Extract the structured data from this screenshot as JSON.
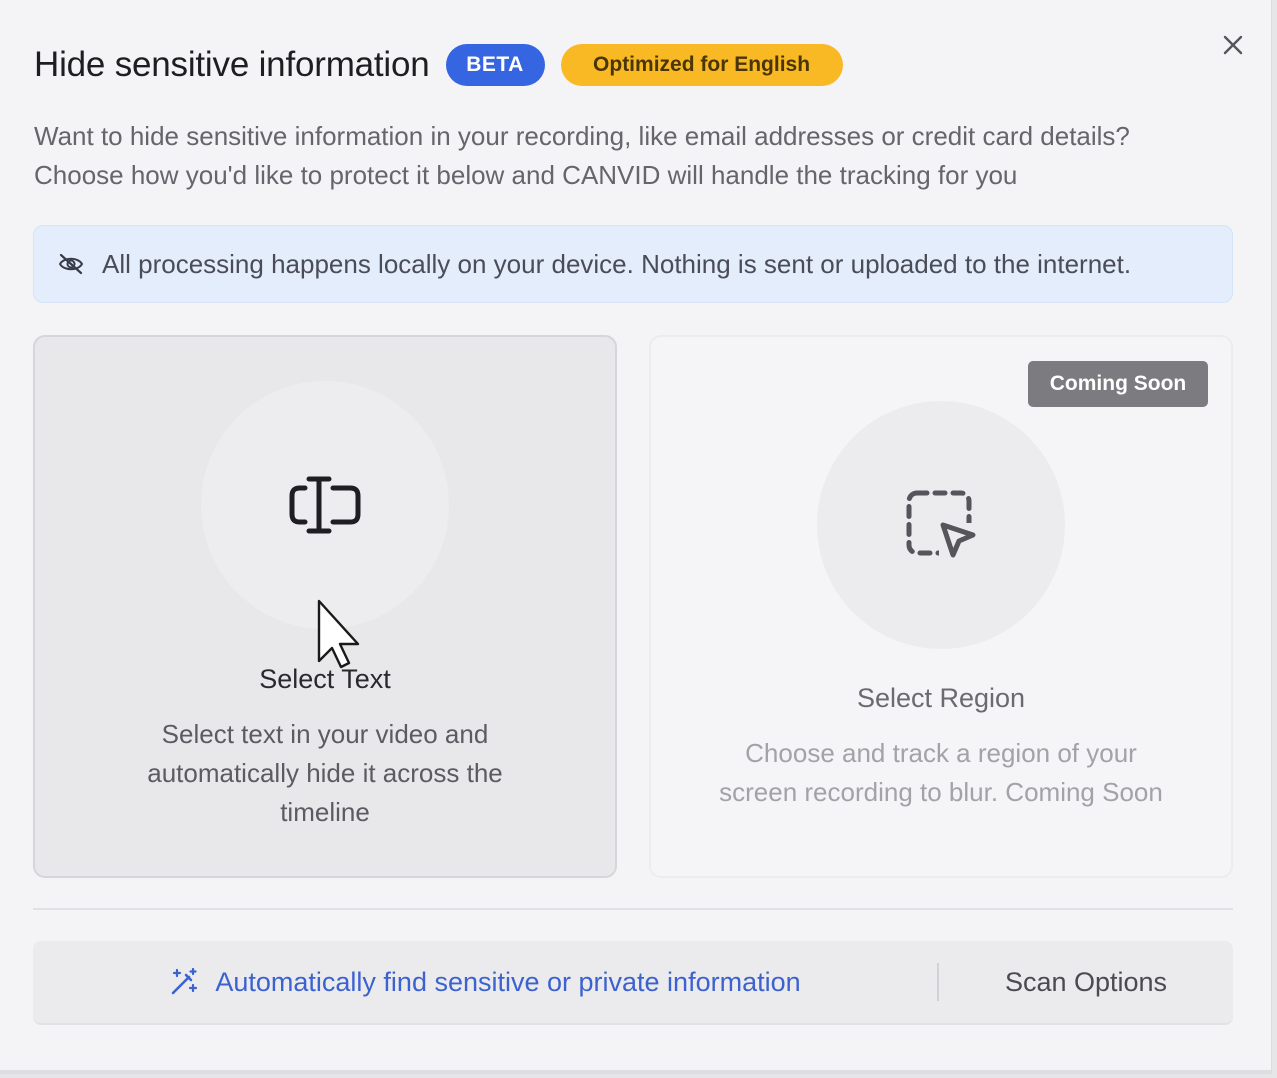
{
  "dialog": {
    "title": "Hide sensitive information",
    "badges": {
      "beta": "BETA",
      "language": "Optimized for English"
    },
    "close_icon": "close-icon",
    "description_lines": [
      "Want to hide sensitive information in your recording, like email addresses or credit card details?",
      "Choose how you'd like to protect it below and CANVID will handle the tracking for you"
    ],
    "info_banner": {
      "icon": "eye-off-icon",
      "text": "All processing happens locally on your device. Nothing is sent or uploaded to the internet."
    },
    "options": [
      {
        "icon": "text-cursor-icon",
        "title": "Select Text",
        "description_lines": [
          "Select text in your video and",
          "automatically hide it across the",
          "timeline"
        ],
        "state": "hovered"
      },
      {
        "icon": "region-select-icon",
        "badge": "Coming Soon",
        "title": "Select Region",
        "description_lines": [
          "Choose and track a region of your",
          "screen recording to blur. Coming Soon"
        ],
        "state": "disabled"
      }
    ],
    "footer": {
      "auto_find": {
        "icon": "magic-wand-icon",
        "label": "Automatically find sensitive or private information"
      },
      "scan_options_label": "Scan Options"
    }
  },
  "colors": {
    "beta_badge": "#3665e2",
    "language_badge": "#f9b924",
    "info_banner_bg": "#e4edfb",
    "link_blue": "#3b62cf",
    "coming_soon_badge": "#7b7b80"
  }
}
